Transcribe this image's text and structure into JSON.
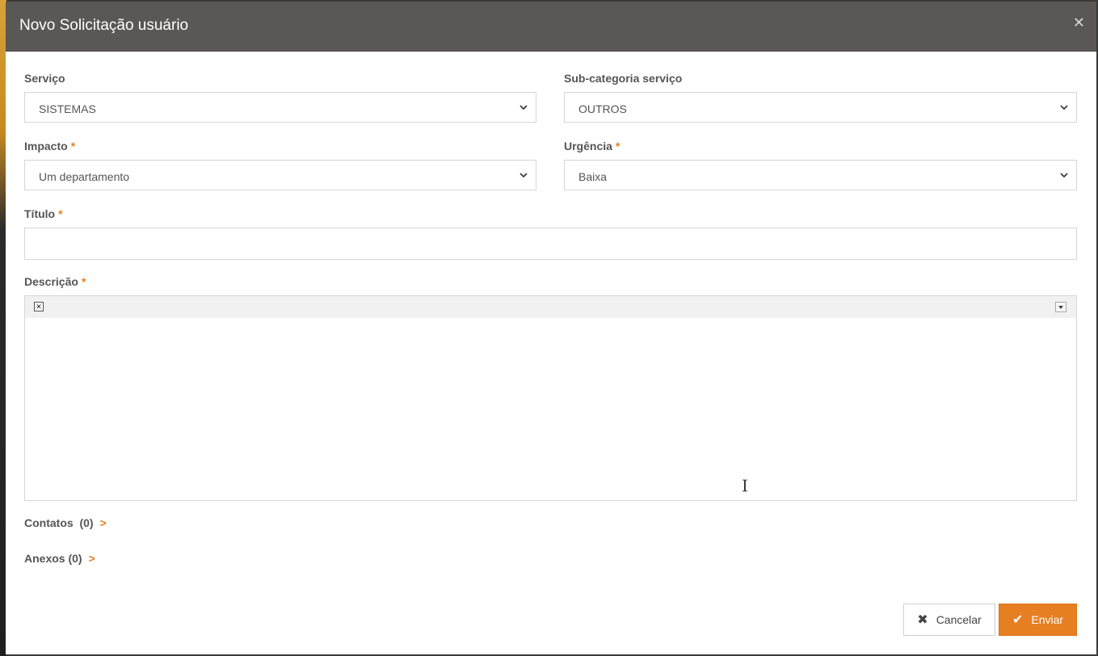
{
  "modal": {
    "title": "Novo Solicitação usuário",
    "close_icon": "close-icon"
  },
  "form": {
    "servico": {
      "label": "Serviço",
      "value": "SISTEMAS"
    },
    "subcategoria": {
      "label": "Sub-categoria serviço",
      "value": "OUTROS"
    },
    "impacto": {
      "label": "Impacto",
      "required": "*",
      "value": "Um departamento"
    },
    "urgencia": {
      "label": "Urgência",
      "required": "*",
      "value": "Baixa"
    },
    "titulo": {
      "label": "Título",
      "required": "*",
      "value": ""
    },
    "descricao": {
      "label": "Descrição",
      "required": "*"
    }
  },
  "sections": {
    "contatos": {
      "label": "Contatos",
      "count": "(0)"
    },
    "anexos": {
      "label": "Anexos (0)"
    }
  },
  "actions": {
    "cancel_label": "Cancelar",
    "send_label": "Enviar"
  },
  "colors": {
    "header_bg": "#595855",
    "accent": "#e67e22"
  }
}
